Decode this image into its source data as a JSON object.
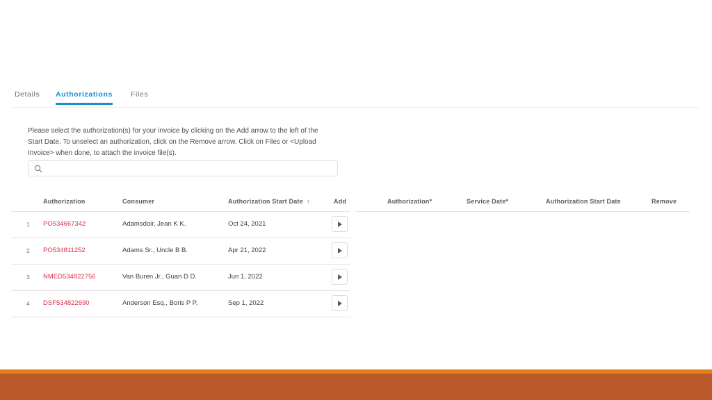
{
  "tabs": [
    {
      "label": "Details",
      "active": false
    },
    {
      "label": "Authorizations",
      "active": true
    },
    {
      "label": "Files",
      "active": false
    }
  ],
  "instructions": "Please select the authorization(s) for your invoice by clicking on the Add arrow to the left of the Start Date. To unselect an authorization, click on the Remove arrow. Click on Files or <Upload Invoice> when done, to attach the invoice file(s).",
  "search": {
    "value": "",
    "placeholder": "",
    "icon": "search-icon"
  },
  "available_table": {
    "headers": {
      "authorization": "Authorization",
      "consumer": "Consumer",
      "start_date": "Authorization Start Date",
      "sort_indicator": "↑",
      "add": "Add"
    },
    "rows": [
      {
        "index": "1",
        "authorization": "PO534667342",
        "consumer": "Adamsdoir, Jean K K.",
        "start_date": "Oct 24, 2021"
      },
      {
        "index": "2",
        "authorization": "PO534811252",
        "consumer": "Adams Sr., Uncle B B.",
        "start_date": "Apr 21, 2022"
      },
      {
        "index": "3",
        "authorization": "NMED534822756",
        "consumer": "Van Buren Jr., Guan D D.",
        "start_date": "Jun 1, 2022"
      },
      {
        "index": "4",
        "authorization": "DSF534822690",
        "consumer": "Anderson Esq., Boris P P.",
        "start_date": "Sep 1, 2022"
      }
    ]
  },
  "selected_table": {
    "headers": {
      "authorization": "Authorization*",
      "service_date": "Service Date*",
      "start_date": "Authorization Start Date",
      "remove": "Remove"
    },
    "rows": []
  },
  "colors": {
    "accent": "#1a8fd0",
    "link": "#d9304c",
    "footer_stripe": "#e0801e",
    "footer": "#bb5a2a"
  }
}
